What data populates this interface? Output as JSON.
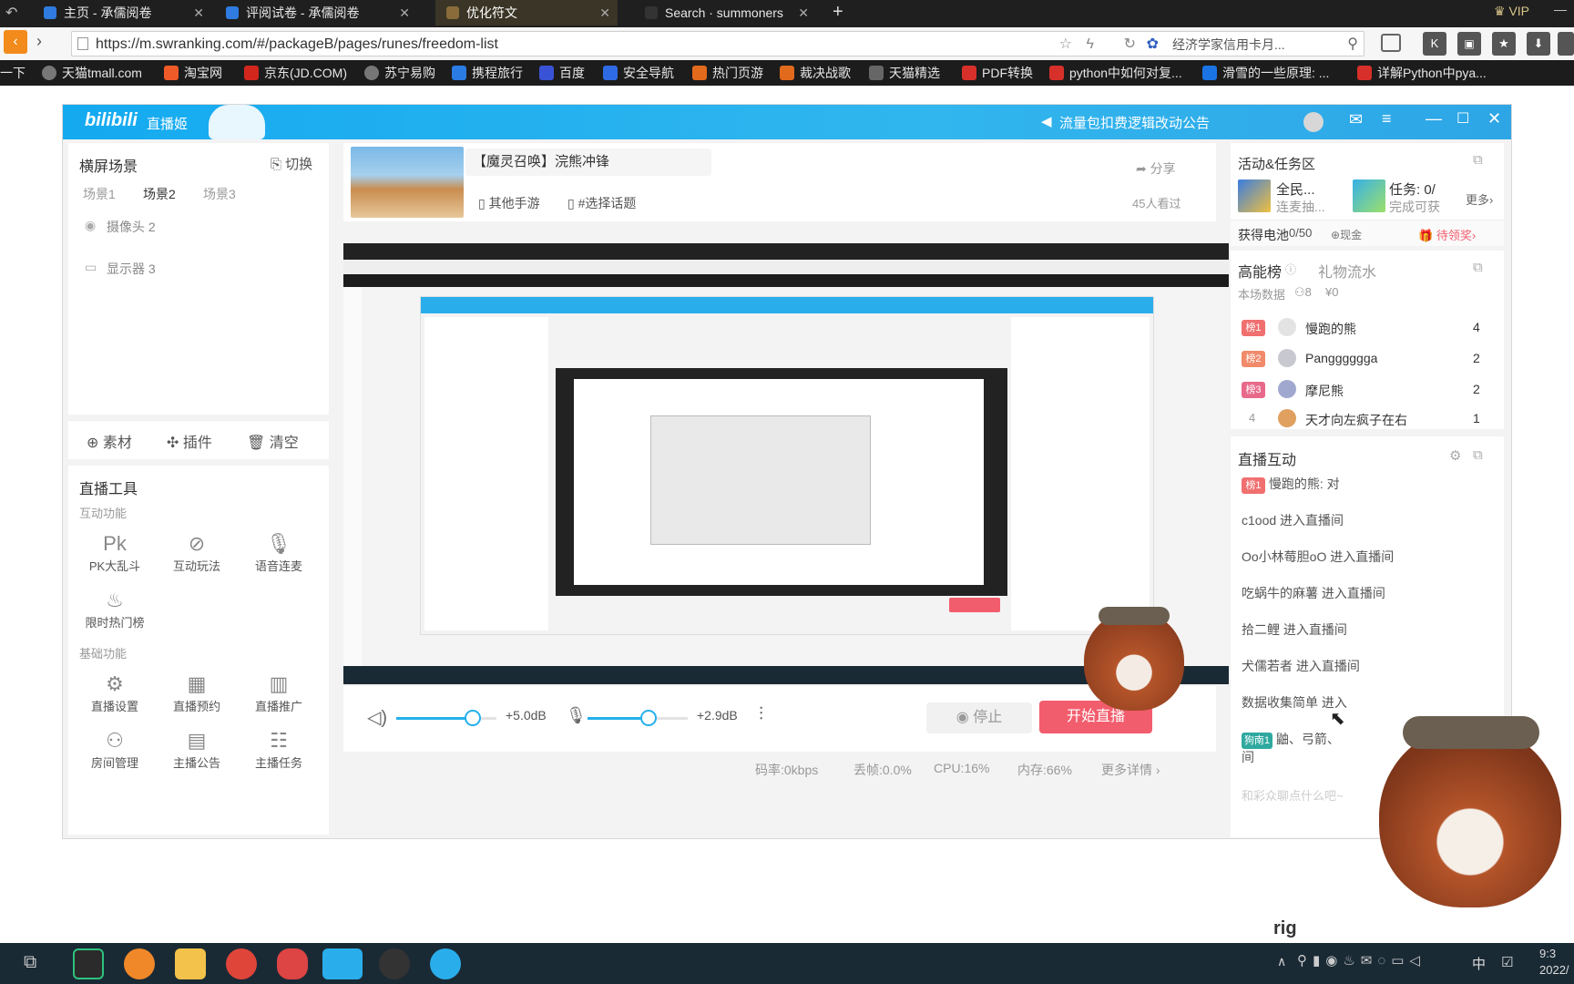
{
  "browser": {
    "tabs": [
      {
        "label": "主页 - 承儒阅卷",
        "active": false
      },
      {
        "label": "评阅试卷 - 承儒阅卷",
        "active": false
      },
      {
        "label": "优化符文",
        "active": true
      },
      {
        "label": "Search · summoners",
        "active": false
      }
    ],
    "new_tab": "+",
    "vip_label": "VIP",
    "url": "https://m.swranking.com/#/packageB/pages/runes/freedom-list",
    "search_hint": "经济学家信用卡月...",
    "bookmarks": [
      "一下",
      "天猫tmall.com",
      "淘宝网",
      "京东(JD.COM)",
      "苏宁易购",
      "携程旅行",
      "百度",
      "安全导航",
      "热门页游",
      "裁决战歌",
      "天猫精选",
      "PDF转换",
      "python中如何对复...",
      "滑雪的一些原理: ...",
      "详解Python中pya..."
    ]
  },
  "app": {
    "brand": "直播姬",
    "announcement": "流量包扣费逻辑改动公告",
    "scene": {
      "title": "横屏场景",
      "switch_label": "切换",
      "tabs": [
        "场景1",
        "场景2",
        "场景3"
      ],
      "sources": [
        "摄像头 2",
        "显示器 3"
      ],
      "actions": [
        "素材",
        "插件",
        "清空"
      ]
    },
    "tools": {
      "title": "直播工具",
      "interactive_label": "互动功能",
      "interactive": [
        "PK大乱斗",
        "互动玩法",
        "语音连麦",
        "限时热门榜"
      ],
      "basic_label": "基础功能",
      "basic": [
        "直播设置",
        "直播预约",
        "直播推广",
        "房间管理",
        "主播公告",
        "主播任务"
      ]
    },
    "stream": {
      "title": "【魔灵召唤】浣熊冲锋",
      "category": "其他手游",
      "topic": "#选择话题",
      "share": "分享",
      "viewers": "45人看过"
    },
    "controls": {
      "speaker_db": "+5.0dB",
      "mic_db": "+2.9dB",
      "stop_label": "停止",
      "start_label": "开始直播",
      "speaker_level": 0.75,
      "mic_level": 0.6
    },
    "status": {
      "bitrate": "码率:0kbps",
      "dropped": "丢帧:0.0%",
      "cpu": "CPU:16%",
      "mem": "内存:66%",
      "more": "更多详情"
    },
    "activity": {
      "title": "活动&任务区",
      "item1_title": "全民...",
      "item1_sub": "连麦抽...",
      "item2_title": "任务: 0/",
      "item2_sub": "完成可获",
      "more": "更多",
      "battery_label": "获得电池",
      "battery_value": "0/50",
      "cash_label": "现金",
      "pending_label": "待领奖"
    },
    "ranking": {
      "tab_active": "高能榜",
      "tab_other": "礼物流水",
      "scope": "本场数据",
      "people": "8",
      "yen": "0",
      "entries": [
        {
          "badge": "榜1",
          "name": "慢跑的熊",
          "score": "4"
        },
        {
          "badge": "榜2",
          "name": "Pangggggga",
          "score": "2"
        },
        {
          "badge": "榜3",
          "name": "摩尼熊",
          "score": "2"
        },
        {
          "badge": "4",
          "name": "天才向左疯子在右",
          "score": "1"
        }
      ]
    },
    "interaction": {
      "title": "直播互动",
      "messages": [
        {
          "badge": "榜1",
          "text": "慢跑的熊: 对"
        },
        {
          "badge": "",
          "text": "c1ood 进入直播间"
        },
        {
          "badge": "",
          "text": "Oo小林莓胆oO 进入直播间"
        },
        {
          "badge": "",
          "text": "吃蜗牛的麻薯 进入直播间"
        },
        {
          "badge": "",
          "text": "拾二鲤 进入直播间"
        },
        {
          "badge": "",
          "text": "犬儒若者 进入直播间"
        },
        {
          "badge": "",
          "text": "数据收集简单 进入"
        },
        {
          "badge": "狗南1",
          "text": "鼬、弓箭、"
        },
        {
          "badge": "",
          "text": "间"
        },
        {
          "badge": "",
          "text": "和彩众聊点什么吧~"
        }
      ]
    }
  },
  "overlay": {
    "watermark": "rig"
  },
  "taskbar": {
    "ime": "中",
    "clock_time": "9:3",
    "clock_date": "2022/"
  },
  "colors": {
    "brand_blue": "#23ade5",
    "start_red": "#f25d6d",
    "tab_active_bg": "#3a3526"
  }
}
